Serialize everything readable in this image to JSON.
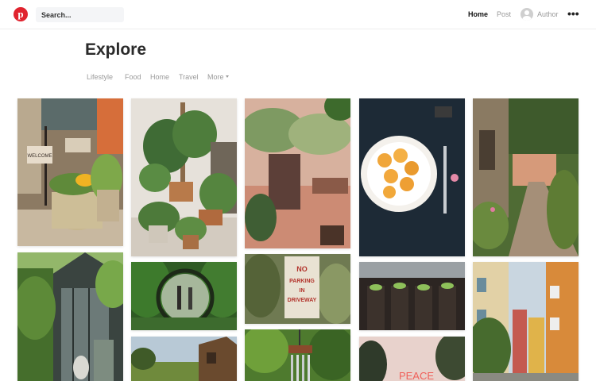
{
  "header": {
    "logo_letter": "p",
    "search_placeholder": "Search...",
    "nav": {
      "home": "Home",
      "post": "Post",
      "author": "Author"
    },
    "more_label": "•••"
  },
  "page": {
    "title": "Explore",
    "tabs": [
      "Lifestyle",
      "Food",
      "Home",
      "Travel",
      "More"
    ]
  },
  "colors": {
    "brand": "#e0232e",
    "active_nav": "#111111",
    "muted_nav": "#999999"
  },
  "images": {
    "welcome_sign_text": "WELCOME",
    "no_parking_sign_text": "NO PARKING IN DRIVEWAY",
    "neon_text": "PEACE"
  }
}
